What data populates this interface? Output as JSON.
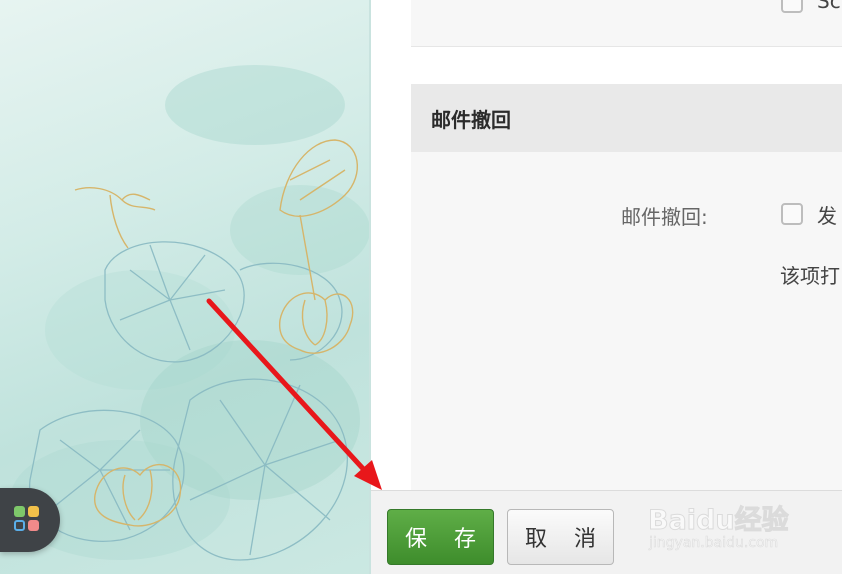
{
  "top_card": {
    "option_text_fragment": "Sc"
  },
  "mail_recall": {
    "section_title": "邮件撤回",
    "field_label": "邮件撤回:",
    "checkbox_label_fragment": "发",
    "checked": false,
    "hint_fragment": "该项打"
  },
  "actions": {
    "save_label": "保 存",
    "cancel_label": "取 消"
  },
  "watermark": {
    "brand": "Baidu经验",
    "url": "jingyan.baidu.com"
  },
  "colors": {
    "save_button": "#4e9e3a",
    "annotation_arrow": "#e8171b",
    "launcher_dots": [
      "#7ec86a",
      "#f2c14a",
      "#5aaee8",
      "#f08a8a"
    ]
  },
  "icons": {
    "launcher": "app-grid-icon",
    "annotation": "red-arrow-pointing-to-save"
  }
}
